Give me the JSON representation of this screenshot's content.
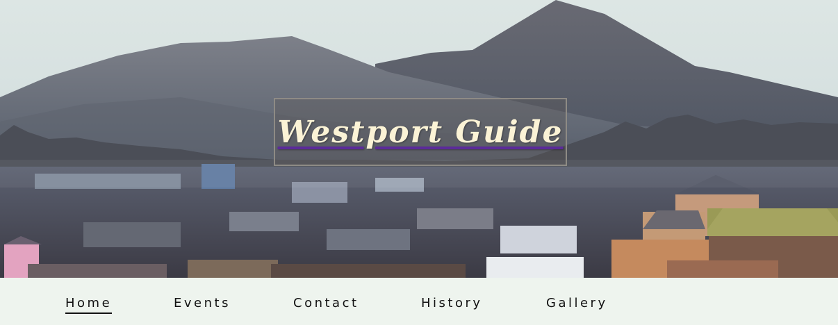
{
  "header": {
    "title": "Westport Guide",
    "banner_image": "town-and-mountain-photo"
  },
  "nav": {
    "items": [
      {
        "label": "Home",
        "active": true
      },
      {
        "label": "Events",
        "active": false
      },
      {
        "label": "Contact",
        "active": false
      },
      {
        "label": "History",
        "active": false
      },
      {
        "label": "Gallery",
        "active": false
      }
    ]
  },
  "colors": {
    "nav_background": "#eef4ee",
    "title_text": "#fbf3d6",
    "title_underline": "#5b2a9a"
  }
}
